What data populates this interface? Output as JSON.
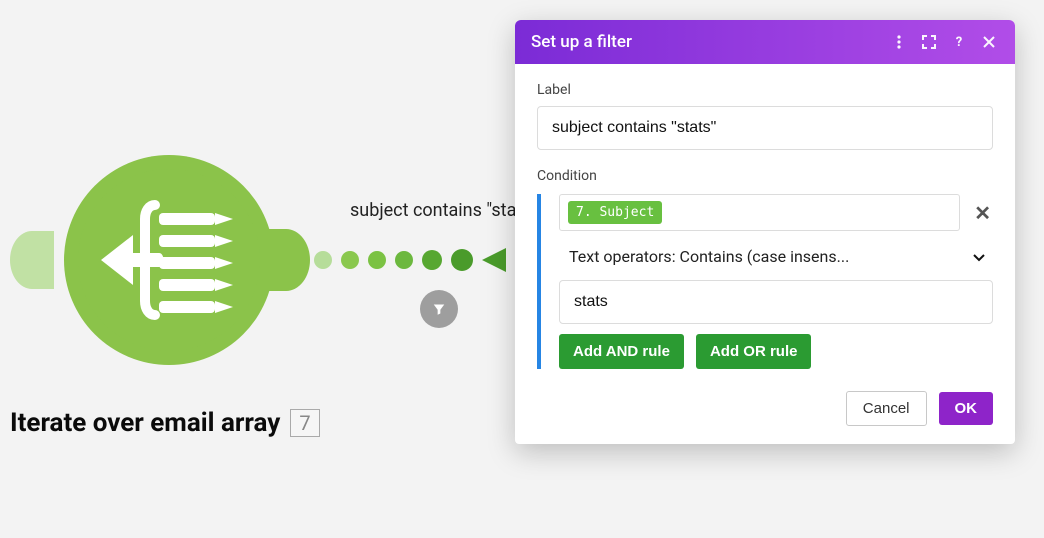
{
  "node": {
    "title": "Iterate over email array",
    "count": "7",
    "connector_label": "subject contains \"stats\""
  },
  "modal": {
    "title": "Set up a filter",
    "label_field_label": "Label",
    "label_field_value": "subject contains \"stats\"",
    "condition_label": "Condition",
    "condition": {
      "chip": "7. Subject",
      "operator": "Text operators: Contains (case insens...",
      "value": "stats"
    },
    "add_and": "Add AND rule",
    "add_or": "Add OR rule",
    "cancel": "Cancel",
    "ok": "OK"
  }
}
